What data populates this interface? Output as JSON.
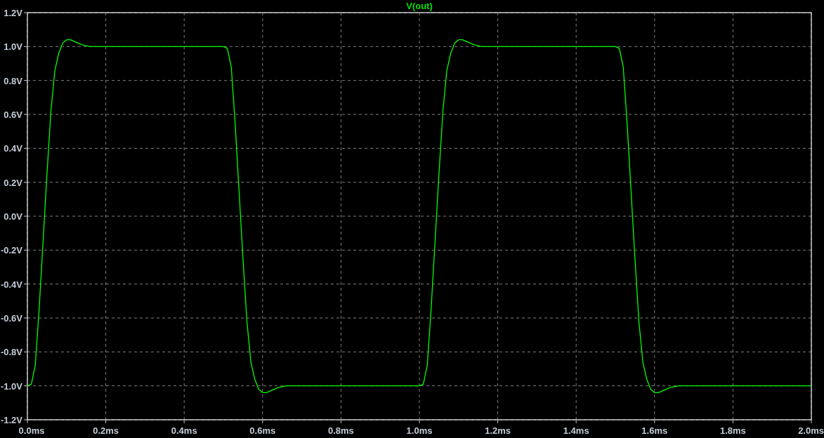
{
  "plot": {
    "chart_data": {
      "type": "line",
      "grid": true,
      "xlim": [
        0,
        2
      ],
      "ylim": [
        -1.2,
        1.2
      ],
      "xticks": [
        {
          "value": 0,
          "label": "0.0ms"
        },
        {
          "value": 0.2,
          "label": "0.2ms"
        },
        {
          "value": 0.4,
          "label": "0.4ms"
        },
        {
          "value": 0.6,
          "label": "0.6ms"
        },
        {
          "value": 0.8,
          "label": "0.8ms"
        },
        {
          "value": 1.0,
          "label": "1.0ms"
        },
        {
          "value": 1.2,
          "label": "1.2ms"
        },
        {
          "value": 1.4,
          "label": "1.4ms"
        },
        {
          "value": 1.6,
          "label": "1.6ms"
        },
        {
          "value": 1.8,
          "label": "1.8ms"
        },
        {
          "value": 2.0,
          "label": "2.0ms"
        }
      ],
      "yticks": [
        {
          "value": 1.2,
          "label": "1.2V"
        },
        {
          "value": 1.0,
          "label": "1.0V"
        },
        {
          "value": 0.8,
          "label": "0.8V"
        },
        {
          "value": 0.6,
          "label": "0.6V"
        },
        {
          "value": 0.4,
          "label": "0.4V"
        },
        {
          "value": 0.2,
          "label": "0.2V"
        },
        {
          "value": 0.0,
          "label": "0.0V"
        },
        {
          "value": -0.2,
          "label": "-0.2V"
        },
        {
          "value": -0.4,
          "label": "-0.4V"
        },
        {
          "value": -0.6,
          "label": "-0.6V"
        },
        {
          "value": -0.8,
          "label": "-0.8V"
        },
        {
          "value": -1.0,
          "label": "-1.0V"
        },
        {
          "value": -1.2,
          "label": "-1.2V"
        }
      ],
      "x": [
        0,
        0.01,
        0.02,
        0.03,
        0.04,
        0.05,
        0.06,
        0.07,
        0.08,
        0.09,
        0.1,
        0.11,
        0.12,
        0.14,
        0.16,
        0.5,
        0.51,
        0.52,
        0.53,
        0.54,
        0.55,
        0.56,
        0.57,
        0.58,
        0.59,
        0.6,
        0.61,
        0.62,
        0.64,
        0.66,
        1.0,
        1.01,
        1.02,
        1.03,
        1.04,
        1.05,
        1.06,
        1.07,
        1.08,
        1.09,
        1.1,
        1.11,
        1.12,
        1.14,
        1.16,
        1.5,
        1.51,
        1.52,
        1.53,
        1.54,
        1.55,
        1.56,
        1.57,
        1.58,
        1.59,
        1.6,
        1.61,
        1.62,
        1.64,
        1.66,
        2.0
      ],
      "series": [
        {
          "name": "V(out)",
          "color": "#00ff00",
          "values": [
            -1.0,
            -0.99,
            -0.88,
            -0.55,
            -0.15,
            0.25,
            0.62,
            0.86,
            0.96,
            1.02,
            1.04,
            1.04,
            1.03,
            1.01,
            1.0,
            1.0,
            0.99,
            0.88,
            0.55,
            0.15,
            -0.25,
            -0.62,
            -0.86,
            -0.96,
            -1.02,
            -1.04,
            -1.04,
            -1.03,
            -1.01,
            -1.0,
            -1.0,
            -0.99,
            -0.88,
            -0.55,
            -0.15,
            0.25,
            0.62,
            0.86,
            0.96,
            1.02,
            1.04,
            1.04,
            1.03,
            1.01,
            1.0,
            1.0,
            0.99,
            0.88,
            0.55,
            0.15,
            -0.25,
            -0.62,
            -0.86,
            -0.96,
            -1.02,
            -1.04,
            -1.04,
            -1.03,
            -1.01,
            -1.0,
            -1.0
          ]
        }
      ]
    }
  }
}
